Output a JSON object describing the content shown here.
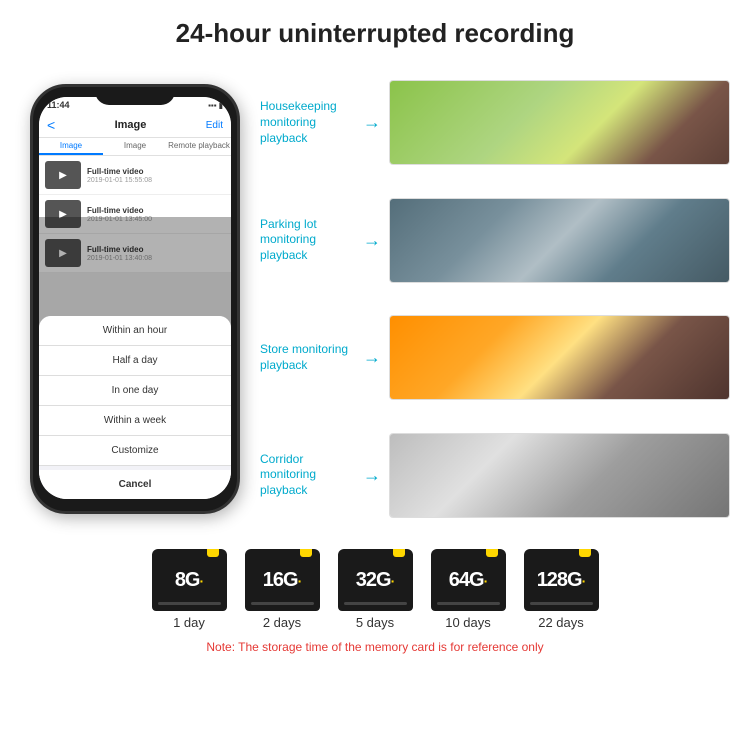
{
  "header": {
    "title": "24-hour uninterrupted recording"
  },
  "phone": {
    "time": "11:44",
    "appTitle": "Image",
    "editLabel": "Edit",
    "backLabel": "<",
    "tabs": [
      "Image",
      "Image",
      "Remote playback"
    ],
    "videos": [
      {
        "title": "Full-time video",
        "date": "2019-01-01 15:55:08"
      },
      {
        "title": "Full-time video",
        "date": "2019-01-01 13:45:00"
      },
      {
        "title": "Full-time video",
        "date": "2019-01-01 13:40:08"
      }
    ],
    "dropdownItems": [
      "Within an hour",
      "Half a day",
      "In one day",
      "Within a week",
      "Customize"
    ],
    "cancelLabel": "Cancel"
  },
  "monitoring": [
    {
      "label": "Housekeeping monitoring playback",
      "imageType": "housekeeping"
    },
    {
      "label": "Parking lot monitoring playback",
      "imageType": "parking"
    },
    {
      "label": "Store monitoring playback",
      "imageType": "store"
    },
    {
      "label": "Corridor monitoring playback",
      "imageType": "corridor"
    }
  ],
  "storage": {
    "cards": [
      {
        "size": "8G",
        "days": "1 day"
      },
      {
        "size": "16G",
        "days": "2 days"
      },
      {
        "size": "32G",
        "days": "5 days"
      },
      {
        "size": "64G",
        "days": "10 days"
      },
      {
        "size": "128G",
        "days": "22 days"
      }
    ],
    "note": "Note: The storage time of the memory card is for reference only"
  }
}
